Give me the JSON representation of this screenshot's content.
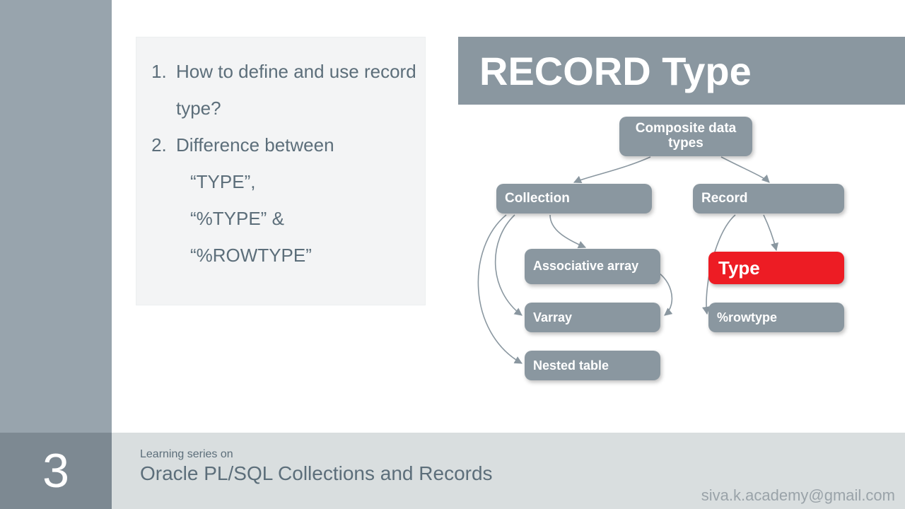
{
  "title": "RECORD Type",
  "questions": {
    "items": [
      "How to define and use record type?",
      "Difference between"
    ],
    "sub": [
      "“TYPE”,",
      "“%TYPE” &",
      "“%ROWTYPE”"
    ]
  },
  "diagram": {
    "root": "Composite data types",
    "collection": "Collection",
    "record": "Record",
    "assoc": "Associative array",
    "varray": "Varray",
    "nested": "Nested table",
    "type": "Type",
    "rowtype": "%rowtype"
  },
  "footer": {
    "slide_number": "3",
    "eyebrow": "Learning series on",
    "headline": "Oracle PL/SQL Collections and Records",
    "email": "siva.k.academy@gmail.com"
  }
}
